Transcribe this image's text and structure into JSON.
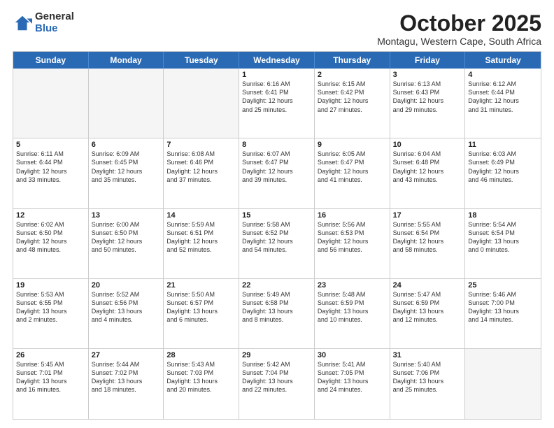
{
  "logo": {
    "general": "General",
    "blue": "Blue"
  },
  "title": "October 2025",
  "subtitle": "Montagu, Western Cape, South Africa",
  "days": [
    "Sunday",
    "Monday",
    "Tuesday",
    "Wednesday",
    "Thursday",
    "Friday",
    "Saturday"
  ],
  "weeks": [
    [
      {
        "day": "",
        "text": "",
        "empty": true
      },
      {
        "day": "",
        "text": "",
        "empty": true
      },
      {
        "day": "",
        "text": "",
        "empty": true
      },
      {
        "day": "1",
        "text": "Sunrise: 6:16 AM\nSunset: 6:41 PM\nDaylight: 12 hours\nand 25 minutes.",
        "empty": false
      },
      {
        "day": "2",
        "text": "Sunrise: 6:15 AM\nSunset: 6:42 PM\nDaylight: 12 hours\nand 27 minutes.",
        "empty": false
      },
      {
        "day": "3",
        "text": "Sunrise: 6:13 AM\nSunset: 6:43 PM\nDaylight: 12 hours\nand 29 minutes.",
        "empty": false
      },
      {
        "day": "4",
        "text": "Sunrise: 6:12 AM\nSunset: 6:44 PM\nDaylight: 12 hours\nand 31 minutes.",
        "empty": false
      }
    ],
    [
      {
        "day": "5",
        "text": "Sunrise: 6:11 AM\nSunset: 6:44 PM\nDaylight: 12 hours\nand 33 minutes.",
        "empty": false
      },
      {
        "day": "6",
        "text": "Sunrise: 6:09 AM\nSunset: 6:45 PM\nDaylight: 12 hours\nand 35 minutes.",
        "empty": false
      },
      {
        "day": "7",
        "text": "Sunrise: 6:08 AM\nSunset: 6:46 PM\nDaylight: 12 hours\nand 37 minutes.",
        "empty": false
      },
      {
        "day": "8",
        "text": "Sunrise: 6:07 AM\nSunset: 6:47 PM\nDaylight: 12 hours\nand 39 minutes.",
        "empty": false
      },
      {
        "day": "9",
        "text": "Sunrise: 6:05 AM\nSunset: 6:47 PM\nDaylight: 12 hours\nand 41 minutes.",
        "empty": false
      },
      {
        "day": "10",
        "text": "Sunrise: 6:04 AM\nSunset: 6:48 PM\nDaylight: 12 hours\nand 43 minutes.",
        "empty": false
      },
      {
        "day": "11",
        "text": "Sunrise: 6:03 AM\nSunset: 6:49 PM\nDaylight: 12 hours\nand 46 minutes.",
        "empty": false
      }
    ],
    [
      {
        "day": "12",
        "text": "Sunrise: 6:02 AM\nSunset: 6:50 PM\nDaylight: 12 hours\nand 48 minutes.",
        "empty": false
      },
      {
        "day": "13",
        "text": "Sunrise: 6:00 AM\nSunset: 6:50 PM\nDaylight: 12 hours\nand 50 minutes.",
        "empty": false
      },
      {
        "day": "14",
        "text": "Sunrise: 5:59 AM\nSunset: 6:51 PM\nDaylight: 12 hours\nand 52 minutes.",
        "empty": false
      },
      {
        "day": "15",
        "text": "Sunrise: 5:58 AM\nSunset: 6:52 PM\nDaylight: 12 hours\nand 54 minutes.",
        "empty": false
      },
      {
        "day": "16",
        "text": "Sunrise: 5:56 AM\nSunset: 6:53 PM\nDaylight: 12 hours\nand 56 minutes.",
        "empty": false
      },
      {
        "day": "17",
        "text": "Sunrise: 5:55 AM\nSunset: 6:54 PM\nDaylight: 12 hours\nand 58 minutes.",
        "empty": false
      },
      {
        "day": "18",
        "text": "Sunrise: 5:54 AM\nSunset: 6:54 PM\nDaylight: 13 hours\nand 0 minutes.",
        "empty": false
      }
    ],
    [
      {
        "day": "19",
        "text": "Sunrise: 5:53 AM\nSunset: 6:55 PM\nDaylight: 13 hours\nand 2 minutes.",
        "empty": false
      },
      {
        "day": "20",
        "text": "Sunrise: 5:52 AM\nSunset: 6:56 PM\nDaylight: 13 hours\nand 4 minutes.",
        "empty": false
      },
      {
        "day": "21",
        "text": "Sunrise: 5:50 AM\nSunset: 6:57 PM\nDaylight: 13 hours\nand 6 minutes.",
        "empty": false
      },
      {
        "day": "22",
        "text": "Sunrise: 5:49 AM\nSunset: 6:58 PM\nDaylight: 13 hours\nand 8 minutes.",
        "empty": false
      },
      {
        "day": "23",
        "text": "Sunrise: 5:48 AM\nSunset: 6:59 PM\nDaylight: 13 hours\nand 10 minutes.",
        "empty": false
      },
      {
        "day": "24",
        "text": "Sunrise: 5:47 AM\nSunset: 6:59 PM\nDaylight: 13 hours\nand 12 minutes.",
        "empty": false
      },
      {
        "day": "25",
        "text": "Sunrise: 5:46 AM\nSunset: 7:00 PM\nDaylight: 13 hours\nand 14 minutes.",
        "empty": false
      }
    ],
    [
      {
        "day": "26",
        "text": "Sunrise: 5:45 AM\nSunset: 7:01 PM\nDaylight: 13 hours\nand 16 minutes.",
        "empty": false
      },
      {
        "day": "27",
        "text": "Sunrise: 5:44 AM\nSunset: 7:02 PM\nDaylight: 13 hours\nand 18 minutes.",
        "empty": false
      },
      {
        "day": "28",
        "text": "Sunrise: 5:43 AM\nSunset: 7:03 PM\nDaylight: 13 hours\nand 20 minutes.",
        "empty": false
      },
      {
        "day": "29",
        "text": "Sunrise: 5:42 AM\nSunset: 7:04 PM\nDaylight: 13 hours\nand 22 minutes.",
        "empty": false
      },
      {
        "day": "30",
        "text": "Sunrise: 5:41 AM\nSunset: 7:05 PM\nDaylight: 13 hours\nand 24 minutes.",
        "empty": false
      },
      {
        "day": "31",
        "text": "Sunrise: 5:40 AM\nSunset: 7:06 PM\nDaylight: 13 hours\nand 25 minutes.",
        "empty": false
      },
      {
        "day": "",
        "text": "",
        "empty": true
      }
    ]
  ]
}
